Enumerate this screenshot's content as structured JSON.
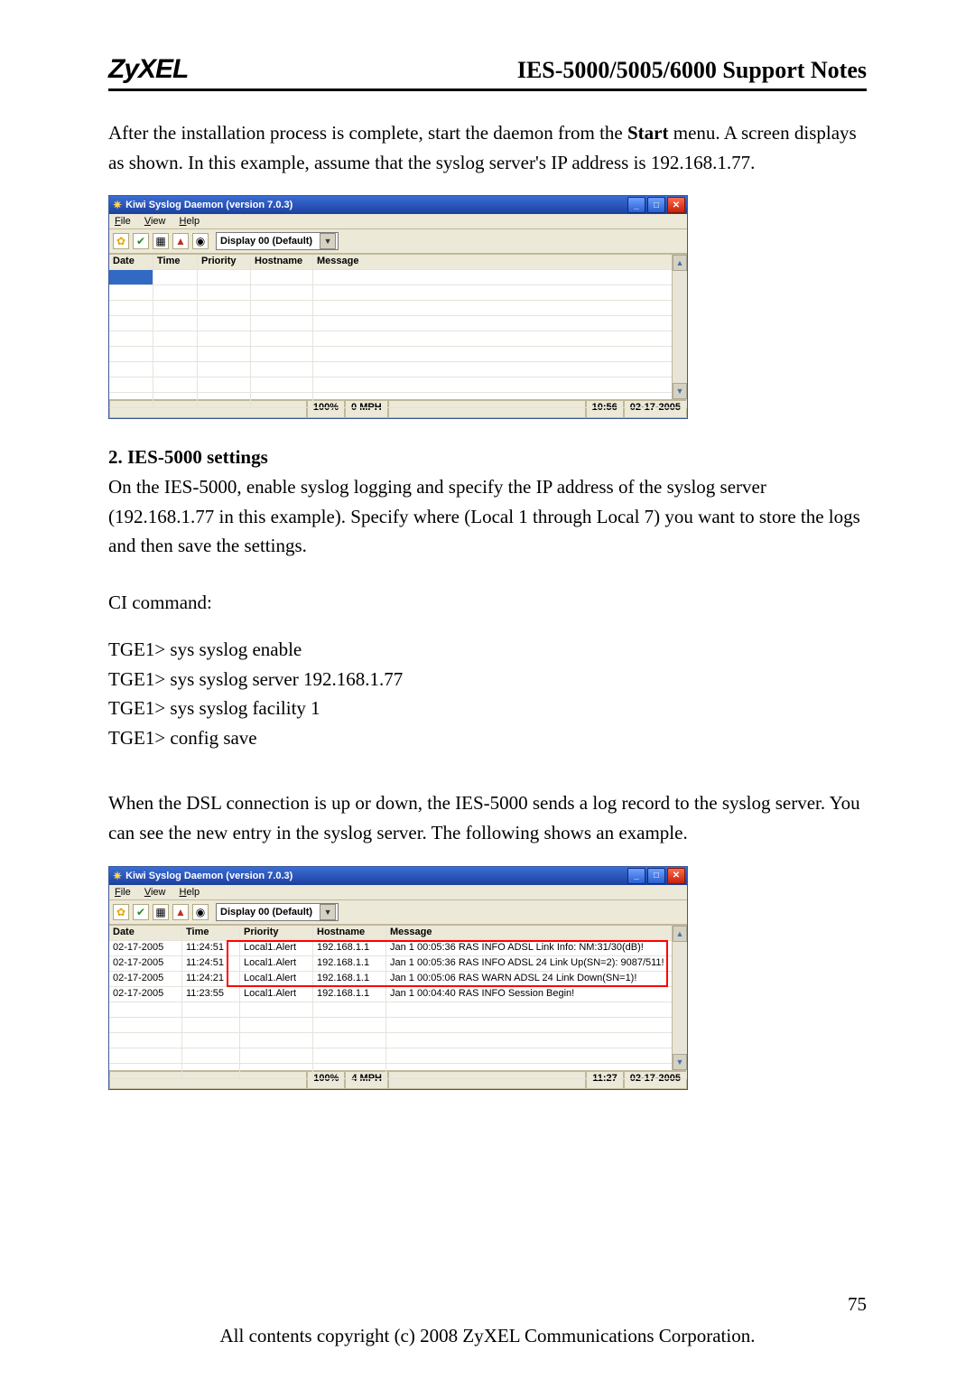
{
  "header": {
    "brand": "ZyXEL",
    "doc_title": "IES-5000/5005/6000 Support Notes"
  },
  "para1": "After the installation process is complete, start the daemon from the Start menu. A screen displays as shown. In this example, assume that the syslog server's IP address is 192.168.1.77.",
  "section2_title": "2. IES-5000 settings",
  "para2": "On the IES-5000, enable syslog logging and specify the IP address of the syslog server (192.168.1.77 in this example). Specify where (Local 1 through Local 7) you want to store the logs and then save the settings.",
  "ci_label": "CI command:",
  "ci_commands": "TGE1> sys syslog enable\nTGE1> sys syslog server 192.168.1.77\nTGE1> sys syslog facility 1\nTGE1> config save",
  "para3": "When the DSL connection is up or down, the IES-5000 sends a log record to the syslog server. You can see the new entry in the syslog server. The following shows an example.",
  "kiwi": {
    "title": "Kiwi Syslog Daemon (version 7.0.3)",
    "menu": {
      "file": "File",
      "view": "View",
      "help": "Help"
    },
    "display_label": "Display 00 (Default)",
    "columns": {
      "date": "Date",
      "time": "Time",
      "priority": "Priority",
      "hostname": "Hostname",
      "message": "Message"
    }
  },
  "status1": {
    "pct": "100%",
    "mph": "0 MPH",
    "time": "10:56",
    "date": "02-17-2005"
  },
  "status2": {
    "pct": "100%",
    "mph": "4 MPH",
    "time": "11:27",
    "date": "02-17-2005"
  },
  "log_rows": [
    {
      "date": "02-17-2005",
      "time": "11:24:51",
      "priority": "Local1.Alert",
      "hostname": "192.168.1.1",
      "message": "Jan  1 00:05:36 RAS  INFO  ADSL Link Info: NM:31/30(dB)!"
    },
    {
      "date": "02-17-2005",
      "time": "11:24:51",
      "priority": "Local1.Alert",
      "hostname": "192.168.1.1",
      "message": "Jan  1 00:05:36 RAS  INFO  ADSL 24 Link Up(SN=2): 9087/511!"
    },
    {
      "date": "02-17-2005",
      "time": "11:24:21",
      "priority": "Local1.Alert",
      "hostname": "192.168.1.1",
      "message": "Jan  1 00:05:06 RAS  WARN  ADSL 24 Link Down(SN=1)!"
    },
    {
      "date": "02-17-2005",
      "time": "11:23:55",
      "priority": "Local1.Alert",
      "hostname": "192.168.1.1",
      "message": "Jan  1 00:04:40 RAS  INFO  Session Begin!"
    }
  ],
  "page_number": "75",
  "footer": "All contents copyright (c) 2008 ZyXEL Communications Corporation."
}
